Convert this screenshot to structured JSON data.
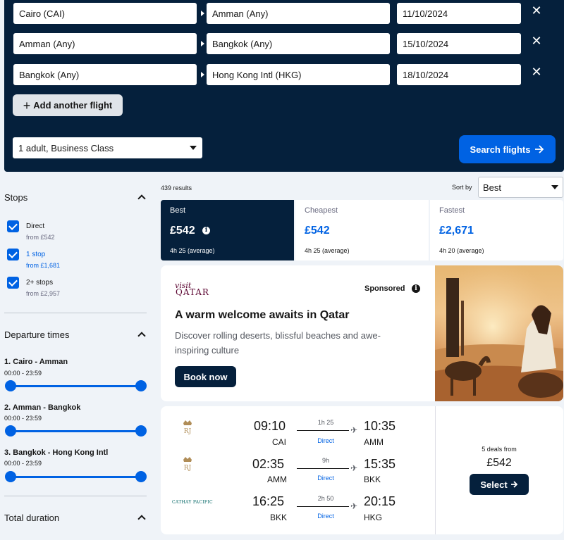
{
  "search": {
    "legs": [
      {
        "from": "Cairo (CAI)",
        "to": "Amman (Any)",
        "date": "11/10/2024"
      },
      {
        "from": "Amman (Any)",
        "to": "Bangkok (Any)",
        "date": "15/10/2024"
      },
      {
        "from": "Bangkok (Any)",
        "to": "Hong Kong Intl (HKG)",
        "date": "18/10/2024"
      }
    ],
    "add_flight_label": "Add another flight",
    "travellers": "1 adult, Business Class",
    "search_label": "Search flights"
  },
  "filters": {
    "stops": {
      "title": "Stops",
      "options": [
        {
          "label": "Direct",
          "sub": "from £542",
          "checked": true
        },
        {
          "label": "1 stop",
          "sub": "from £1,681",
          "checked": true
        },
        {
          "label": "2+ stops",
          "sub": "from £2,957",
          "checked": true
        }
      ]
    },
    "departure": {
      "title": "Departure times",
      "routes": [
        {
          "name": "1. Cairo - Amman",
          "range": "00:00 - 23:59"
        },
        {
          "name": "2. Amman - Bangkok",
          "range": "00:00 - 23:59"
        },
        {
          "name": "3. Bangkok - Hong Kong Intl",
          "range": "00:00 - 23:59"
        }
      ]
    },
    "duration": {
      "title": "Total duration"
    }
  },
  "results": {
    "count": "439 results",
    "sort_label": "Sort by",
    "sort_value": "Best"
  },
  "tabs": [
    {
      "label": "Best",
      "price": "£542",
      "duration": "4h 25 (average)"
    },
    {
      "label": "Cheapest",
      "price": "£542",
      "duration": "4h 25 (average)"
    },
    {
      "label": "Fastest",
      "price": "£2,671",
      "duration": "4h 20 (average)"
    }
  ],
  "ad": {
    "logo_small": "visit",
    "logo_big": "QATAR",
    "sponsored": "Sponsored",
    "headline": "A warm welcome awaits in Qatar",
    "body": "Discover rolling deserts, blissful beaches and awe-inspiring culture",
    "button": "Book now"
  },
  "itinerary": {
    "legs": [
      {
        "dep_time": "09:10",
        "dep_code": "CAI",
        "duration": "1h 25",
        "stops": "Direct",
        "arr_time": "10:35",
        "arr_code": "AMM",
        "airline_icon": "royal-jordanian-logo"
      },
      {
        "dep_time": "02:35",
        "dep_code": "AMM",
        "duration": "9h",
        "stops": "Direct",
        "arr_time": "15:35",
        "arr_code": "BKK",
        "airline_icon": "royal-jordanian-logo"
      },
      {
        "dep_time": "16:25",
        "dep_code": "BKK",
        "duration": "2h 50",
        "stops": "Direct",
        "arr_time": "20:15",
        "arr_code": "HKG",
        "airline_icon": "cathay-pacific-logo",
        "airline_text": "CATHAY PACIFIC"
      }
    ],
    "deals": "5 deals from",
    "price": "£542",
    "select_label": "Select"
  },
  "colors": {
    "navy": "#05203c",
    "accent_blue": "#0062e3",
    "page_bg": "#eff3f8"
  }
}
